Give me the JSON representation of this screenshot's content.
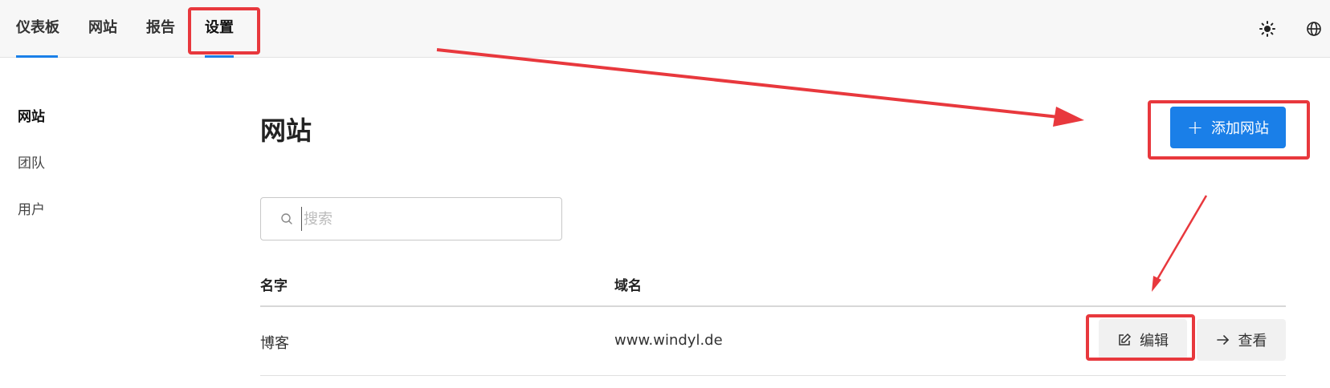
{
  "topnav": {
    "items": [
      {
        "label": "仪表板"
      },
      {
        "label": "网站"
      },
      {
        "label": "报告"
      },
      {
        "label": "设置"
      }
    ],
    "theme_icon": "sun-icon",
    "language_icon": "globe-icon"
  },
  "sidebar": {
    "items": [
      {
        "label": "网站"
      },
      {
        "label": "团队"
      },
      {
        "label": "用户"
      }
    ]
  },
  "main": {
    "title": "网站",
    "add_button": {
      "label": "添加网站",
      "icon": "plus-icon"
    },
    "search": {
      "placeholder": "搜索",
      "value": ""
    },
    "table": {
      "columns": [
        "名字",
        "域名"
      ],
      "rows": [
        {
          "name": "博客",
          "domain": "www.windyl.de",
          "edit_label": "编辑",
          "view_label": "查看"
        }
      ]
    }
  },
  "colors": {
    "accent": "#1a7fe8",
    "annotation": "#e8383d"
  }
}
